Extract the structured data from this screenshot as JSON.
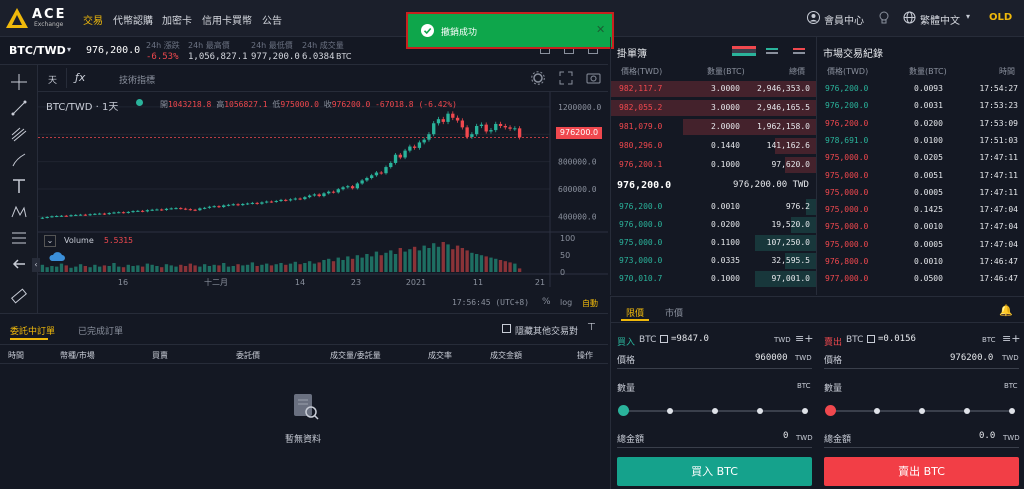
{
  "nav": {
    "logo_text": "ACE",
    "logo_sub": "Exchange",
    "items": [
      "交易",
      "代幣認購",
      "加密卡",
      "信用卡買幣",
      "公告"
    ],
    "member": "會員中心",
    "language": "繁體中文",
    "old": "OLD"
  },
  "toast": {
    "message": "撤銷成功"
  },
  "ticker": {
    "pair": "BTC/TWD",
    "price": "976,200.0",
    "change_label": "24h 漲跌",
    "change_value": "-6.53%",
    "high_label": "24h 最高價",
    "high_value": "1,056,827.1",
    "low_label": "24h 最低價",
    "low_value": "977,200.0",
    "vol_label": "24h 成交量",
    "vol_value": "6.0384",
    "vol_unit": "BTC"
  },
  "chart_toolbar": {
    "interval": "天",
    "indicator": "技術指標"
  },
  "chart_data": {
    "type": "candlestick",
    "legend_pair": "BTC/TWD · 1天",
    "ohlc_text": {
      "open_label": "開",
      "open": "1043218.8",
      "high_label": "高",
      "high": "1056827.1",
      "low_label": "低",
      "low": "975000.0",
      "close_label": "收",
      "close": "976200.0",
      "change": "-67018.8 (-6.42%)"
    },
    "y_ticks": [
      "1200000.0",
      "1000000.0",
      "800000.0",
      "600000.0",
      "400000.0"
    ],
    "vol_ticks": [
      "100",
      "50",
      "0"
    ],
    "x_ticks": [
      "16",
      "十二月",
      "14",
      "23",
      "2021",
      "11",
      "21"
    ],
    "last_price_label": "976200.0",
    "ylim": [
      300000,
      1250000
    ],
    "volume_label": "Volume",
    "volume_value": "5.5315",
    "closes": [
      390000,
      395000,
      400000,
      402000,
      404000,
      402000,
      408000,
      410000,
      412000,
      409000,
      415000,
      418000,
      420000,
      416000,
      424000,
      428000,
      430000,
      426000,
      432000,
      438000,
      440000,
      436000,
      445000,
      448000,
      450000,
      446000,
      455000,
      458000,
      460000,
      456000,
      452000,
      448000,
      445000,
      458000,
      462000,
      470000,
      474000,
      468000,
      480000,
      484000,
      488000,
      482000,
      490000,
      494000,
      498000,
      492000,
      502000,
      508000,
      506000,
      512000,
      520000,
      516000,
      524000,
      530000,
      526000,
      540000,
      552000,
      560000,
      548000,
      568000,
      580000,
      575000,
      598000,
      612000,
      620000,
      605000,
      640000,
      662000,
      680000,
      700000,
      720000,
      715000,
      760000,
      790000,
      850000,
      830000,
      880000,
      910000,
      900000,
      940000,
      960000,
      1000000,
      1080000,
      1110000,
      1090000,
      1150000,
      1120000,
      1100000,
      1050000,
      980000,
      1000000,
      1060000,
      1070000,
      1020000,
      1030000,
      1075000,
      1060000,
      1050000,
      1040000,
      1043000,
      976200
    ],
    "volumes": [
      12,
      8,
      10,
      9,
      14,
      11,
      7,
      9,
      13,
      10,
      8,
      12,
      9,
      11,
      10,
      15,
      9,
      8,
      12,
      10,
      11,
      9,
      14,
      12,
      10,
      8,
      13,
      11,
      9,
      12,
      10,
      14,
      11,
      9,
      13,
      10,
      12,
      11,
      15,
      9,
      10,
      13,
      11,
      12,
      16,
      10,
      12,
      14,
      11,
      13,
      15,
      12,
      14,
      17,
      13,
      15,
      18,
      14,
      16,
      20,
      22,
      18,
      24,
      20,
      26,
      22,
      28,
      24,
      30,
      26,
      34,
      28,
      32,
      36,
      30,
      40,
      34,
      38,
      42,
      36,
      44,
      40,
      48,
      42,
      50,
      46,
      38,
      44,
      40,
      36,
      32,
      30,
      28,
      26,
      24,
      22,
      20,
      18,
      16,
      14,
      6
    ],
    "time_label": "17:56:45 (UTC+8)",
    "pct": "%",
    "log": "log",
    "auto": "自動"
  },
  "orders": {
    "tabs": [
      "委託中訂單",
      "已完成訂單"
    ],
    "hide_others": "隱藏其他交易對",
    "columns": [
      "時間",
      "幣種/市場",
      "買賣",
      "委託價",
      "成交量/委託量",
      "成交率",
      "成交金額",
      "操作"
    ],
    "empty": "暫無資料"
  },
  "book": {
    "title": "掛單簿",
    "columns": [
      "價格(TWD)",
      "數量(BTC)",
      "總價"
    ],
    "asks": [
      {
        "price": "982,117.7",
        "qty": "3.0000",
        "total": "2,946,353.0",
        "depth": 1.0
      },
      {
        "price": "982,055.2",
        "qty": "3.0000",
        "total": "2,946,165.5",
        "depth": 1.0
      },
      {
        "price": "981,079.0",
        "qty": "2.0000",
        "total": "1,962,158.0",
        "depth": 0.65
      },
      {
        "price": "980,296.0",
        "qty": "0.1440",
        "total": "141,162.6",
        "depth": 0.2
      },
      {
        "price": "976,200.1",
        "qty": "0.1000",
        "total": "97,620.0",
        "depth": 0.15
      }
    ],
    "mid_price": "976,200.0",
    "mid_twd": "976,200.00 TWD",
    "bids": [
      {
        "price": "976,200.0",
        "qty": "0.0010",
        "total": "976.2",
        "depth": 0.05
      },
      {
        "price": "976,000.0",
        "qty": "0.0200",
        "total": "19,520.0",
        "depth": 0.12
      },
      {
        "price": "975,000.0",
        "qty": "0.1100",
        "total": "107,250.0",
        "depth": 0.3
      },
      {
        "price": "973,000.0",
        "qty": "0.0335",
        "total": "32,595.5",
        "depth": 0.15
      },
      {
        "price": "970,010.7",
        "qty": "0.1000",
        "total": "97,001.0",
        "depth": 0.3
      }
    ]
  },
  "trades": {
    "title": "市場交易紀錄",
    "columns": [
      "價格(TWD)",
      "數量(BTC)",
      "時間"
    ],
    "rows": [
      {
        "price": "976,200.0",
        "qty": "0.0093",
        "time": "17:54:27",
        "side": "buy"
      },
      {
        "price": "976,200.0",
        "qty": "0.0031",
        "time": "17:53:23",
        "side": "buy"
      },
      {
        "price": "976,200.0",
        "qty": "0.0200",
        "time": "17:53:09",
        "side": "sell"
      },
      {
        "price": "978,691.0",
        "qty": "0.0100",
        "time": "17:51:03",
        "side": "buy"
      },
      {
        "price": "975,000.0",
        "qty": "0.0205",
        "time": "17:47:11",
        "side": "sell"
      },
      {
        "price": "975,000.0",
        "qty": "0.0051",
        "time": "17:47:11",
        "side": "sell"
      },
      {
        "price": "975,000.0",
        "qty": "0.0005",
        "time": "17:47:11",
        "side": "sell"
      },
      {
        "price": "975,000.0",
        "qty": "0.1425",
        "time": "17:47:04",
        "side": "sell"
      },
      {
        "price": "975,000.0",
        "qty": "0.0010",
        "time": "17:47:04",
        "side": "sell"
      },
      {
        "price": "975,000.0",
        "qty": "0.0005",
        "time": "17:47:04",
        "side": "sell"
      },
      {
        "price": "976,800.0",
        "qty": "0.0010",
        "time": "17:46:47",
        "side": "sell"
      },
      {
        "price": "977,000.0",
        "qty": "0.0500",
        "time": "17:46:47",
        "side": "sell"
      }
    ]
  },
  "trade_panel": {
    "tabs": [
      "限價",
      "市價"
    ],
    "buy": {
      "title": "買入",
      "coin": "BTC",
      "balance": "=9847.0",
      "bal_unit": "TWD",
      "price_label": "價格",
      "price_value": "960000",
      "price_unit": "TWD",
      "qty_label": "數量",
      "qty_unit": "BTC",
      "total_label": "總金額",
      "total_value": "0",
      "total_unit": "TWD",
      "button": "買入 BTC"
    },
    "sell": {
      "title": "賣出",
      "coin": "BTC",
      "balance": "=0.0156",
      "bal_unit": "BTC",
      "price_label": "價格",
      "price_value": "976200.0",
      "price_unit": "TWD",
      "qty_label": "數量",
      "qty_unit": "BTC",
      "total_label": "總金額",
      "total_value": "0.0",
      "total_unit": "TWD",
      "button": "賣出 BTC"
    }
  },
  "colors": {
    "up": "#2ab39b",
    "down": "#f0484e",
    "accent": "#f0b90b",
    "toast": "#0ea64b"
  }
}
